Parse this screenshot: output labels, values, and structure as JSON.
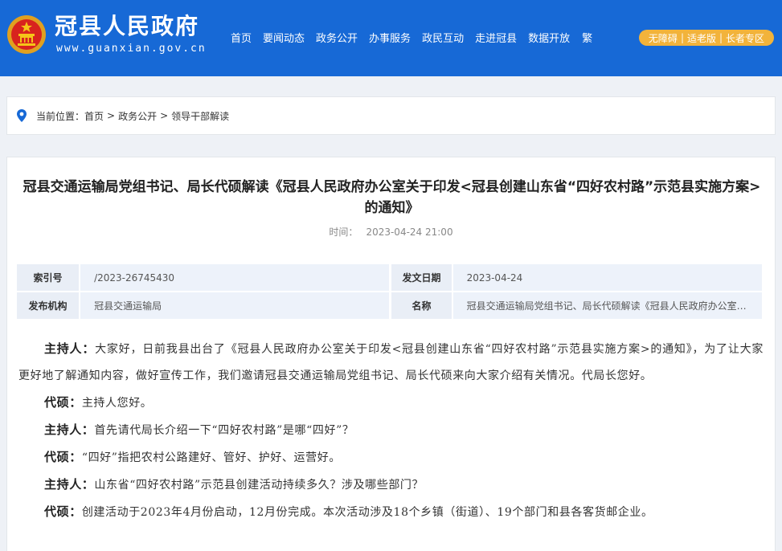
{
  "header": {
    "site_name": "冠县人民政府",
    "site_url": "www.guanxian.gov.cn",
    "nav": [
      "首页",
      "要闻动态",
      "政务公开",
      "办事服务",
      "政民互动",
      "走进冠县",
      "数据开放"
    ],
    "traditional": "繁",
    "accessibility": [
      "无障碍",
      "适老版",
      "长者专区"
    ],
    "accessibility_sep": "|",
    "accessibility_color": "#f2b33b",
    "brand_color": "#1769d6"
  },
  "breadcrumb": {
    "icon": "location-pin-icon",
    "label": "当前位置：",
    "items": [
      "首页",
      "政务公开",
      "领导干部解读"
    ],
    "sep": ">"
  },
  "article": {
    "title": "冠县交通运输局党组书记、局长代硕解读《冠县人民政府办公室关于印发<冠县创建山东省“四好农村路”示范县实施方案>的通知》",
    "time_label": "时间：",
    "time_value": "2023-04-24 21:00",
    "info": {
      "index_label": "索引号",
      "index_value": "/2023-26745430",
      "date_label": "发文日期",
      "date_value": "2023-04-24",
      "org_label": "发布机构",
      "org_value": "冠县交通运输局",
      "name_label": "名称",
      "name_value": "冠县交通运输局党组书记、局长代硕解读《冠县人民政府办公室关于印发<冠县创建山东省“四好农村路”示范县实施方案>的通知》"
    },
    "paragraphs": [
      {
        "speaker": "主持人：",
        "text": "大家好，日前我县出台了《冠县人民政府办公室关于印发<冠县创建山东省“四好农村路”示范县实施方案>的通知》，为了让大家更好地了解通知内容，做好宣传工作，我们邀请冠县交通运输局党组书记、局长代硕来向大家介绍有关情况。代局长您好。"
      },
      {
        "speaker": "代硕：",
        "text": "主持人您好。"
      },
      {
        "speaker": "主持人：",
        "text": "首先请代局长介绍一下“四好农村路”是哪“四好”？"
      },
      {
        "speaker": "代硕：",
        "text": "“四好”指把农村公路建好、管好、护好、运营好。"
      },
      {
        "speaker": "主持人：",
        "text": "山东省“四好农村路”示范县创建活动持续多久？涉及哪些部门？"
      },
      {
        "speaker": "代硕：",
        "text": "创建活动于2023年4月份启动，12月份完成。本次活动涉及18个乡镇（街道）、19个部门和县各客货邮企业。"
      }
    ]
  }
}
